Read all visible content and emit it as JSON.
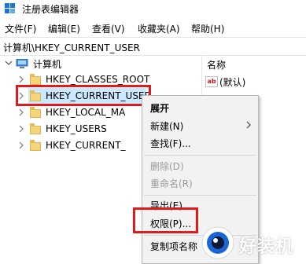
{
  "window": {
    "title": "注册表编辑器"
  },
  "menubar": {
    "items": [
      "文件(F)",
      "编辑(E)",
      "查看(V)",
      "收藏夹(A)",
      "帮助(H)"
    ]
  },
  "address": {
    "path": "计算机\\HKEY_CURRENT_USER"
  },
  "tree": {
    "root_label": "计算机",
    "items": [
      {
        "label": "HKEY_CLASSES_ROOT"
      },
      {
        "label": "HKEY_CURRENT_USER"
      },
      {
        "label": "HKEY_LOCAL_MA"
      },
      {
        "label": "HKEY_USERS"
      },
      {
        "label": "HKEY_CURRENT_"
      }
    ]
  },
  "right_pane": {
    "header": "名称",
    "first_value": "(默认)",
    "bottom_partial": "复制项名称"
  },
  "context_menu": {
    "items": [
      {
        "label": "展开"
      },
      {
        "label": "新建(N)"
      },
      {
        "label": "查找(F)..."
      },
      {
        "label": "删除(D)"
      },
      {
        "label": "重命名(R)"
      },
      {
        "label": "导出(E)"
      },
      {
        "label": "权限(P)..."
      },
      {
        "label": "复制项名称"
      }
    ]
  },
  "watermark": {
    "text": "好装机"
  },
  "colors": {
    "highlight_box": "#e11b1b",
    "selection": "#cce8ff",
    "menu_bg": "#f2f2f2",
    "disabled_text": "#9a9a9a"
  }
}
